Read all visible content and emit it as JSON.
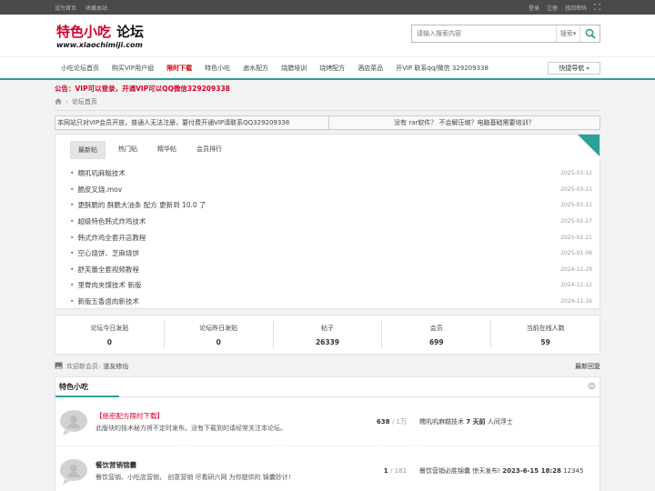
{
  "topbar": {
    "left": [
      "设为首页",
      "收藏本站"
    ],
    "right": [
      "登录",
      "注册",
      "找回密码"
    ]
  },
  "logo": {
    "cn_main": "特色小吃",
    "cn_bold": "论坛",
    "url": "www.xiaochimiji.com"
  },
  "search": {
    "placeholder": "请输入搜索内容",
    "select": "搜索",
    "colors": {
      "accent": "#2aa09a"
    }
  },
  "nav": {
    "items": [
      "小吃论坛首页",
      "购买VIP用户组",
      "限时下载",
      "特色小吃",
      "卤水配方",
      "烧腊培训",
      "烧烤配方",
      "酒店菜品",
      "开VIP 联系qq/微信 329209338"
    ],
    "hot_index": 2,
    "quick": "快捷导航"
  },
  "notice": "公告：VIP可以登录，开通VIP可以QQ微信329209338",
  "breadcrumb": {
    "home_icon": "home-icon",
    "current": "论坛首页"
  },
  "bar2": {
    "left": "本网站只对VIP会员开放，普通人无法注册，要付费开通VIP请联系QQ329209338",
    "right": "没有 rar软件？ 不会解压缩？电脑基础需要培训？"
  },
  "tabs": [
    "最新帖",
    "热门贴",
    "精华帖",
    "会员排行"
  ],
  "posts": [
    {
      "title": "糯叽叽麻糍技术",
      "date": "2025-03-12"
    },
    {
      "title": "脆皮叉烧.mov",
      "date": "2025-03-11"
    },
    {
      "title": "更酥脆的 酥脆大油条 配方 更新到 10.0 了",
      "date": "2025-03-11"
    },
    {
      "title": "超级特色韩式炸鸡技术",
      "date": "2025-02-27"
    },
    {
      "title": "韩式炸鸡全套开店教程",
      "date": "2025-02-21"
    },
    {
      "title": "空心烧饼、芝麻烧饼",
      "date": "2025-01-06"
    },
    {
      "title": "舒芙蕾全套视频教程",
      "date": "2024-12-29"
    },
    {
      "title": "里脊肉夹馍技术 新版",
      "date": "2024-12-12"
    },
    {
      "title": "新版五香卤肉新技术",
      "date": "2024-11-16"
    }
  ],
  "stats": [
    {
      "label": "论坛今日发贴",
      "value": "0"
    },
    {
      "label": "论坛昨日发贴",
      "value": "0"
    },
    {
      "label": "帖子",
      "value": "26339"
    },
    {
      "label": "会员",
      "value": "699"
    },
    {
      "label": "当前在线人数",
      "value": "59"
    }
  ],
  "welcome": {
    "text": "欢迎新会员:",
    "member": "道友修仙",
    "right": "最新回复"
  },
  "forum": {
    "title": "特色小吃",
    "rows": [
      {
        "name": "【绝密配方限时下载】",
        "desc": "此版块的技术秘方将不定时发布。没有下载到的请经常关注本论坛。",
        "count": "638",
        "total": "/ 1万",
        "last": "糯叽叽麻糍技术",
        "last_time": "7 天前",
        "last_user": "人间浮士"
      },
      {
        "name": "餐饮营销锦囊",
        "desc": "餐饮营销、小吃店营销， 创意营销 尽看研六网 为你提供的 锦囊妙计!",
        "count": "1",
        "total": "/ 182",
        "last": "餐饮营销必胜锦囊 惊天发布!",
        "last_time": "2023-6-15 18:28",
        "last_user": "12345"
      }
    ]
  }
}
